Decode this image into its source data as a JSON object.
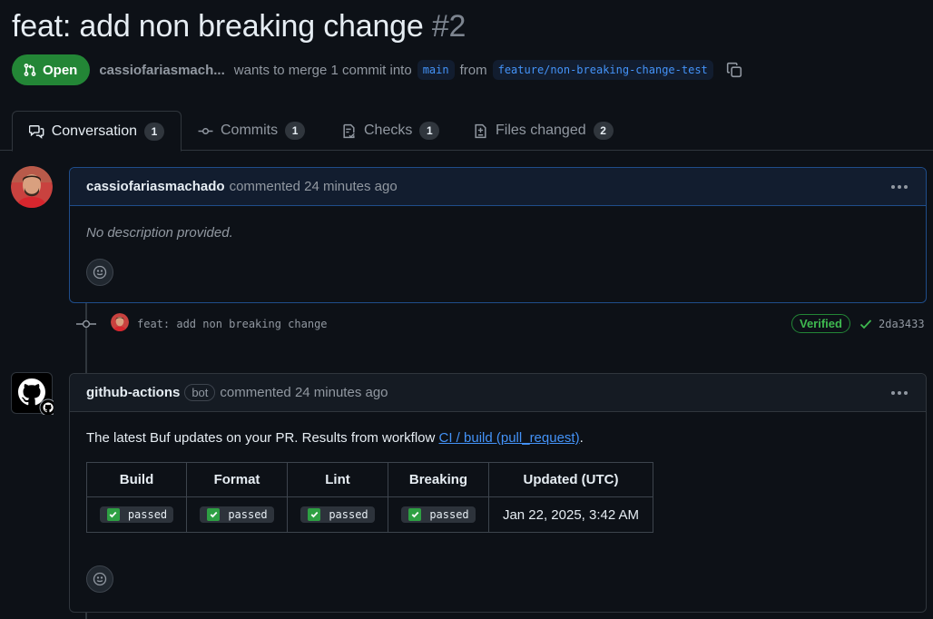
{
  "pr": {
    "title": "feat: add non breaking change",
    "number": "#2",
    "state": "Open",
    "author": "cassiofariasmach...",
    "merge_text": "wants to merge 1 commit into",
    "base_branch": "main",
    "from_text": "from",
    "head_branch": "feature/non-breaking-change-test"
  },
  "tabs": [
    {
      "label": "Conversation",
      "count": "1",
      "icon": "comment-discussion-icon"
    },
    {
      "label": "Commits",
      "count": "1",
      "icon": "git-commit-icon"
    },
    {
      "label": "Checks",
      "count": "1",
      "icon": "checklist-icon"
    },
    {
      "label": "Files changed",
      "count": "2",
      "icon": "file-diff-icon"
    }
  ],
  "comments": [
    {
      "author": "cassiofariasmachado",
      "action": "commented 24 minutes ago",
      "body": "No description provided."
    },
    {
      "author": "github-actions",
      "badge": "bot",
      "action": "commented 24 minutes ago",
      "intro": "The latest Buf updates on your PR. Results from workflow",
      "link_text": "CI / build (pull_request)",
      "end": ".",
      "table": {
        "headers": [
          "Build",
          "Format",
          "Lint",
          "Breaking",
          "Updated (UTC)"
        ],
        "row": [
          "passed",
          "passed",
          "passed",
          "passed",
          "Jan 22, 2025, 3:42 AM"
        ]
      }
    }
  ],
  "commit": {
    "message": "feat: add non breaking change",
    "verified": "Verified",
    "sha": "2da3433"
  },
  "colors": {
    "open_green": "#238636",
    "link_blue": "#4493f8",
    "background": "#0d1117"
  }
}
